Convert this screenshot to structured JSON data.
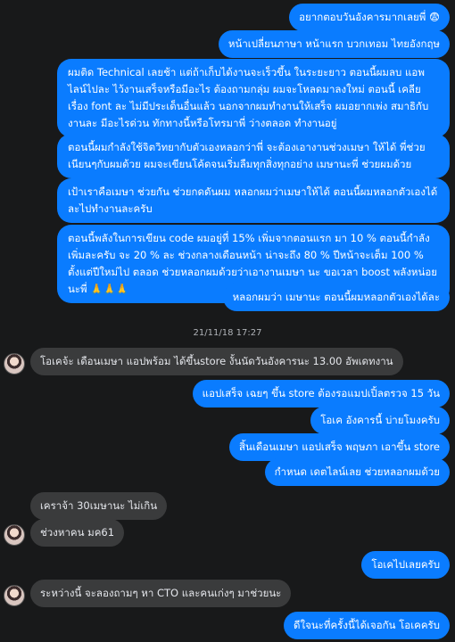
{
  "messages": {
    "m1": "อยากตอบวันอังคารมากเลยพี่ 😨",
    "m2": "หน้าเปลี่ยนภาษา หน้าแรก บวกเทอม ไทยอังกฤษ",
    "m3": "ผมติด Technical เลยช้า แต่ถ้าเก็บได้งานจะเร็วขึ้น ในระยะยาว ตอนนี้ผมลบ แอพไลน์ไปละ ไว้งานเสร็จหรือมีอะไร ต้องถามกลุ่ม ผมจะโหลดมาลงใหม่ ตอนนี้ เคลียเรื่อง font ละ ไม่มีประเด็นอื่นแล้ว นอกจากผมทำงานให้เสร็จ ผมอยากเพ่ง สมาธิกับงานละ มีอะไรด่วน ทักทางนี้หรือโทรมาพี่ ว่างตลอด ทำงานอยู่",
    "m4": "ตอนนี้ผมกำลังใช้จิตวิทยากับตัวเองหลอกว่าพี่ จะต้องเอางานช่วงเมษา ให้ได้ พี่ช่วยเนียนๆกับผมด้วย ผมจะเขียนโค้ดจนเริ่มลืมทุกสิ่งทุกอย่าง เมษานะพี่ ช่วยผมด้วย",
    "m5": "เป้าเราคือเมษา ช่วยกัน ช่วยกดดันผม หลอกผมว่าเมษาให้ได้ ตอนนี้ผมหลอกตัวเองได้ละไปทำงานละครับ",
    "m6": "ตอนนี้พลังในการเขียน code ผมอยู่ที่ 15% เพิ่มจากตอนแรก มา 10 % ตอนนี้กำลังเพิ่มละครับ จะ 20 % ละ ช่วงกลางเดือนหน้า น่าจะถึง 80 % ปีหน้าจะเต็ม 100 % ตั้งแต่ปีใหม่ไป ตลอด ช่วยหลอกผมด้วยว่าเอางานเมษา นะ ขอเวลา boost พลังหน่อยนะพี่ 🙏🙏🙏",
    "m7": "หลอกผมว่า เมษานะ ตอนนี้ผมหลอกตัวเองได้ละ",
    "timestamp": "21/11/18 17:27",
    "m8": "โอเคจ้ะ เดือนเมษา แอปพร้อม ได้ขึ้นstore งั้นนัดวันอังคารนะ 13.00 อัพเดทงาน",
    "m9": "แอปเสร็จ เฉยๆ ขึ้น store ต้องรอแมปเปิ้ลตรวจ 15 วัน",
    "m10": "โอเค อังคารนี้ บ่ายโมงครับ",
    "m11": "สิ้นเดือนเมษา แอปเสร็จ พฤษภา เอาขึ้น store",
    "m12": "กำหนด เดตไลน์เลย ช่วยหลอกผมด้วย",
    "m13": "เคราจ้า 30เมษานะ ไม่เกิน",
    "m14": "ช่วงหาคน มค61",
    "m15": "โอเคไปเลยครับ",
    "m16": "ระหว่างนี้ จะลองถามๆ หา CTO และคนเก่งๆ มาช่วยนะ",
    "m17": "ดีใจนะที่ครั้งนี้ได้เจอกัน โอเคครับ"
  },
  "colors": {
    "background": "#18191a",
    "outgoing": "#0a7cff",
    "incoming": "#3a3b3c"
  }
}
